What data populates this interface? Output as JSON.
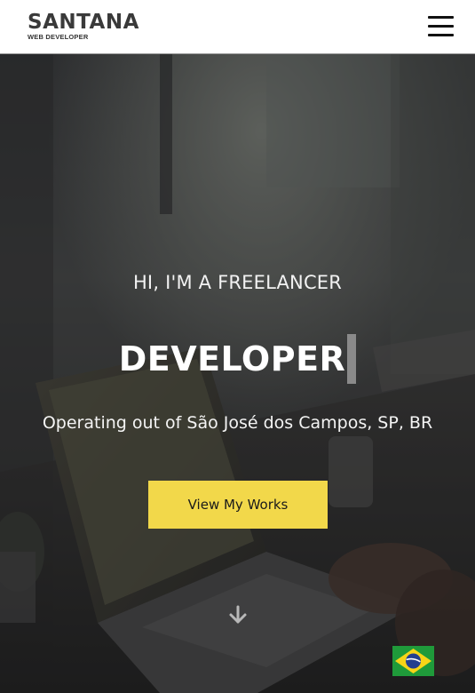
{
  "header": {
    "logo_name": "SANTANA",
    "logo_tagline": "WEB DEVELOPER",
    "menu_icon": "hamburger-menu-icon"
  },
  "hero": {
    "greeting": "HI, I'M A FREELANCER",
    "role": "DEVELOPER",
    "location": "Operating out of São José dos Campos, SP, BR",
    "cta_label": "View My Works",
    "scroll_icon": "arrow-down-icon",
    "language_flag": "brazil-flag-icon"
  },
  "colors": {
    "accent": "#f2d84a",
    "header_bg": "#ffffff",
    "logo_text": "#3a3a3a",
    "hero_text": "#ffffff"
  }
}
